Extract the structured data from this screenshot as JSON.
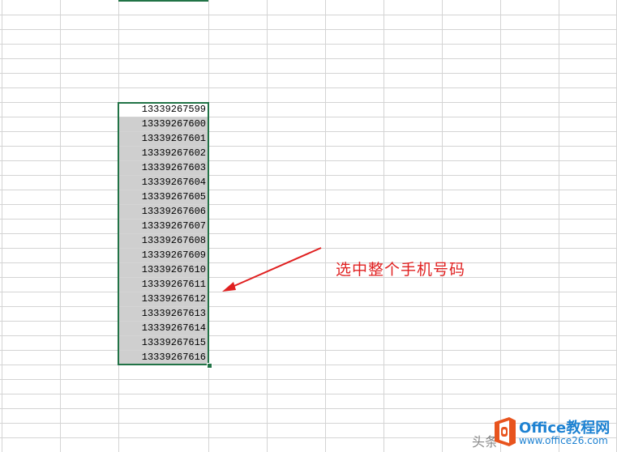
{
  "sheet": {
    "cells": [
      {
        "value": "13339267599",
        "selected_active": true
      },
      {
        "value": "13339267600",
        "selected_active": false
      },
      {
        "value": "13339267601",
        "selected_active": false
      },
      {
        "value": "13339267602",
        "selected_active": false
      },
      {
        "value": "13339267603",
        "selected_active": false
      },
      {
        "value": "13339267604",
        "selected_active": false
      },
      {
        "value": "13339267605",
        "selected_active": false
      },
      {
        "value": "13339267606",
        "selected_active": false
      },
      {
        "value": "13339267607",
        "selected_active": false
      },
      {
        "value": "13339267608",
        "selected_active": false
      },
      {
        "value": "13339267609",
        "selected_active": false
      },
      {
        "value": "13339267610",
        "selected_active": false
      },
      {
        "value": "13339267611",
        "selected_active": false
      },
      {
        "value": "13339267612",
        "selected_active": false
      },
      {
        "value": "13339267613",
        "selected_active": false
      },
      {
        "value": "13339267614",
        "selected_active": false
      },
      {
        "value": "13339267615",
        "selected_active": false
      },
      {
        "value": "13339267616",
        "selected_active": false
      }
    ],
    "selection_color": "#217346",
    "shade_color": "#cfcfcf",
    "gridline_color": "#d4d4d4"
  },
  "annotation": {
    "text": "选中整个手机号码",
    "color": "#e02020"
  },
  "watermark": {
    "prefix": "头条",
    "brand": "Office教程网",
    "url": "www.office26.com",
    "logo_icon": "office-logo-icon",
    "color": "#1e82d2"
  }
}
